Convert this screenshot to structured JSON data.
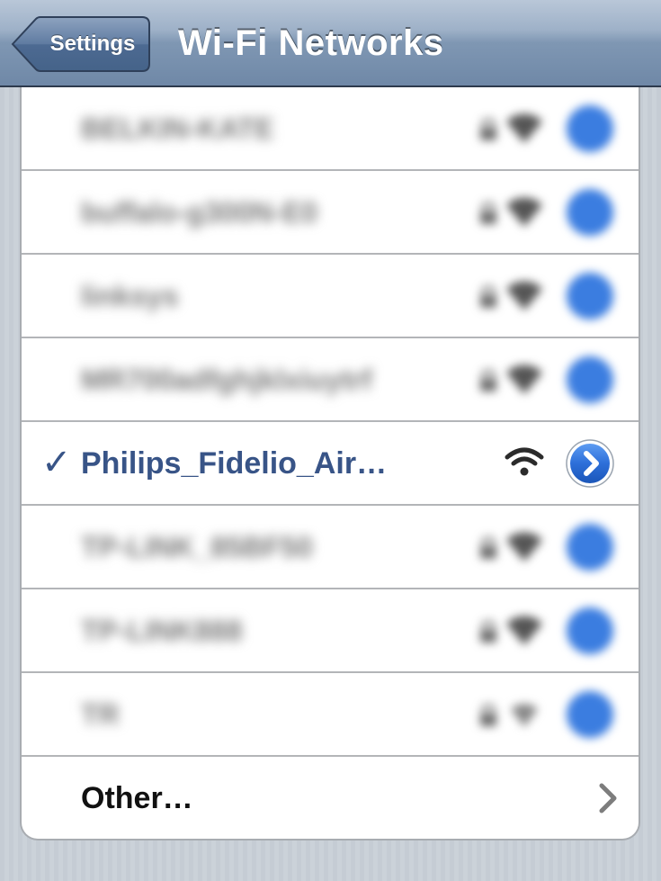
{
  "navbar": {
    "back_label": "Settings",
    "title": "Wi-Fi Networks"
  },
  "networks": [
    {
      "name": "BELKIN-KATE",
      "selected": false,
      "obscured": true,
      "secured": true
    },
    {
      "name": "buffalo-g300N-E0",
      "selected": false,
      "obscured": true,
      "secured": true
    },
    {
      "name": "linksys",
      "selected": false,
      "obscured": true,
      "secured": true
    },
    {
      "name": "MR700adfghjklxiuytrf",
      "selected": false,
      "obscured": true,
      "secured": true
    },
    {
      "name": "Philips_Fidelio_Air…",
      "selected": true,
      "obscured": false,
      "secured": false
    },
    {
      "name": "TP-LINK_85BF50",
      "selected": false,
      "obscured": true,
      "secured": true
    },
    {
      "name": "TP-LINK888",
      "selected": false,
      "obscured": true,
      "secured": true
    },
    {
      "name": "TR",
      "selected": false,
      "obscured": true,
      "secured": true
    }
  ],
  "other": {
    "label": "Other…"
  },
  "icons": {
    "check": "✓",
    "back": "back-arrow-icon",
    "lock": "lock-icon",
    "wifi": "wifi-icon",
    "detail": "detail-disclosure-icon",
    "chevron": "chevron-right-icon"
  },
  "colors": {
    "navbar_top": "#b9c7d8",
    "navbar_bottom": "#6f88a7",
    "selected_text": "#385487",
    "detail_blue": "#2d6fd9",
    "pinstripe": "#c5ccd4"
  }
}
